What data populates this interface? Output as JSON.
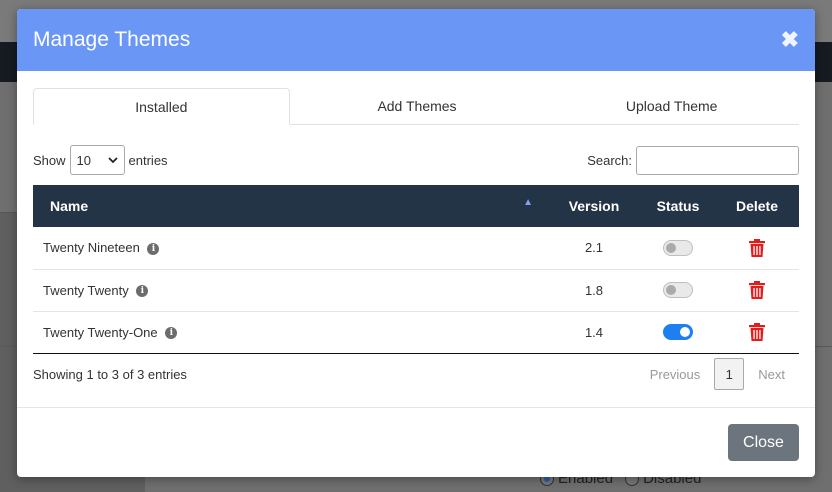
{
  "modal": {
    "title": "Manage Themes",
    "close_icon": "close-icon",
    "tabs": [
      {
        "label": "Installed",
        "active": true
      },
      {
        "label": "Add Themes",
        "active": false
      },
      {
        "label": "Upload Theme",
        "active": false
      }
    ],
    "show_label": "Show",
    "entries_label": "entries",
    "page_length": "10",
    "search_label": "Search:",
    "search_value": "",
    "table": {
      "headers": {
        "name": "Name",
        "version": "Version",
        "status": "Status",
        "delete": "Delete"
      },
      "rows": [
        {
          "name": "Twenty Nineteen",
          "version": "2.1",
          "enabled": false
        },
        {
          "name": "Twenty Twenty",
          "version": "1.8",
          "enabled": false
        },
        {
          "name": "Twenty Twenty-One",
          "version": "1.4",
          "enabled": true
        }
      ]
    },
    "info_text": "Showing 1 to 3 of 3 entries",
    "pagination": {
      "previous": "Previous",
      "current_page": "1",
      "next": "Next"
    },
    "close_button": "Close"
  },
  "background": {
    "radio_enabled": "Enabled",
    "radio_disabled": "Disabled"
  },
  "colors": {
    "header_bg": "#6a97f5",
    "table_header_bg": "#243447",
    "toggle_on": "#1f7ff0",
    "delete_icon": "#e11d1d",
    "close_button_bg": "#6c757d"
  }
}
